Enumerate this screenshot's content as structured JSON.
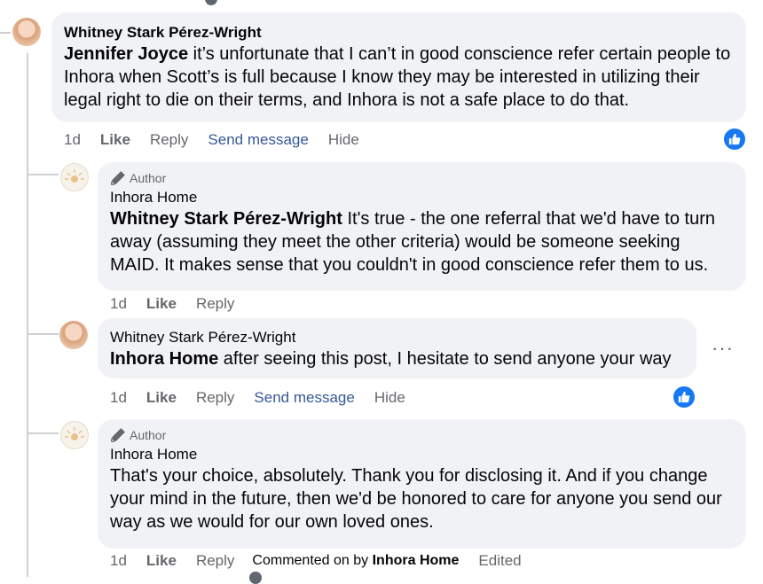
{
  "comment1": {
    "name": "Whitney Stark Pérez-Wright",
    "mention": "Jennifer Joyce",
    "text": " it’s unfortunate that I can’t in good conscience refer certain people to Inhora when Scott’s is full because I know they may be interested in utilizing their legal right to die on their terms, and Inhora is not a safe place to do that.",
    "time": "1d",
    "like": "Like",
    "reply": "Reply",
    "send": "Send message",
    "hide": "Hide"
  },
  "reply1": {
    "author_tag": "Author",
    "name": "Inhora Home",
    "mention": "Whitney Stark Pérez-Wright",
    "text": " It's true - the one referral that we'd have to turn away (assuming they meet the other criteria) would be someone seeking MAID. It makes sense that you couldn't in good conscience refer them to us.",
    "time": "1d",
    "like": "Like",
    "reply": "Reply"
  },
  "reply2": {
    "name": "Whitney Stark Pérez-Wright",
    "mention": "Inhora Home",
    "text": " after seeing this post, I hesitate to send anyone your way",
    "more": "···",
    "time": "1d",
    "like": "Like",
    "reply": "Reply",
    "send": "Send message",
    "hide": "Hide"
  },
  "reply3": {
    "author_tag": "Author",
    "name": "Inhora Home",
    "text": "That's your choice, absolutely. Thank you for disclosing it. And if you change your mind in the future, then we'd be honored to care for anyone you send our way as we would for our own loved ones.",
    "time": "1d",
    "like": "Like",
    "reply": "Reply",
    "commented_prefix": "Commented on by",
    "commented_by": "Inhora Home",
    "edited": "Edited"
  },
  "colors": {
    "like_blue": "#1877f2",
    "link_blue": "#385898",
    "bubble": "#f0f2f5"
  },
  "icons": {
    "like": "thumbs-up-icon",
    "author": "pencil-icon",
    "more": "more-options-icon"
  }
}
